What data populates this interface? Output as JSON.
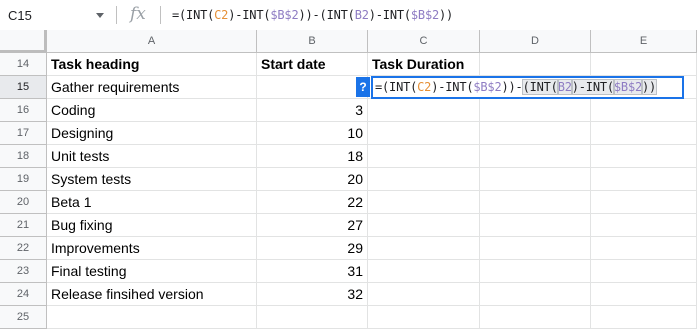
{
  "formula_bar": {
    "cell_ref": "C15",
    "fx_label": "fx",
    "formula_parts": [
      {
        "t": "=(INT(",
        "c": ""
      },
      {
        "t": "C2",
        "c": "ref-c"
      },
      {
        "t": ")-INT(",
        "c": ""
      },
      {
        "t": "$B$2",
        "c": "ref-b"
      },
      {
        "t": "))-(INT(",
        "c": ""
      },
      {
        "t": "B2",
        "c": "ref-b"
      },
      {
        "t": ")-INT(",
        "c": ""
      },
      {
        "t": "$B$2",
        "c": "ref-b"
      },
      {
        "t": "))",
        "c": ""
      }
    ]
  },
  "columns": [
    "A",
    "B",
    "C",
    "D",
    "E"
  ],
  "rows": [
    {
      "num": "14",
      "a": "Task heading",
      "b": "Start date",
      "c": "Task Duration",
      "header": true
    },
    {
      "num": "15",
      "a": "Gather requirements",
      "b": "",
      "c": ""
    },
    {
      "num": "16",
      "a": "Coding",
      "b": "3",
      "c": ""
    },
    {
      "num": "17",
      "a": "Designing",
      "b": "10",
      "c": ""
    },
    {
      "num": "18",
      "a": "Unit tests",
      "b": "18",
      "c": ""
    },
    {
      "num": "19",
      "a": "System tests",
      "b": "20",
      "c": ""
    },
    {
      "num": "20",
      "a": "Beta 1",
      "b": "22",
      "c": ""
    },
    {
      "num": "21",
      "a": "Bug fixing",
      "b": "27",
      "c": ""
    },
    {
      "num": "22",
      "a": "Improvements",
      "b": "29",
      "c": ""
    },
    {
      "num": "23",
      "a": "Final testing",
      "b": "31",
      "c": ""
    },
    {
      "num": "24",
      "a": "Release finsihed version",
      "b": "32",
      "c": ""
    },
    {
      "num": "25",
      "a": "",
      "b": "",
      "c": ""
    }
  ],
  "active_row": "15",
  "editor": {
    "help_badge": "?",
    "formula_parts": [
      {
        "t": "=(INT(",
        "c": ""
      },
      {
        "t": "C2",
        "c": "ref-c"
      },
      {
        "t": ")-INT(",
        "c": ""
      },
      {
        "t": "$B$2",
        "c": "ref-b"
      },
      {
        "t": "))-",
        "c": ""
      },
      {
        "t": "(INT(",
        "c": "",
        "hl": true
      },
      {
        "t": "B2",
        "c": "ref-b",
        "hl": true
      },
      {
        "t": ")-INT(",
        "c": "",
        "hl": true
      },
      {
        "t": "$B$2",
        "c": "ref-b",
        "hl": true
      },
      {
        "t": "))",
        "c": "",
        "hl": true
      }
    ]
  }
}
